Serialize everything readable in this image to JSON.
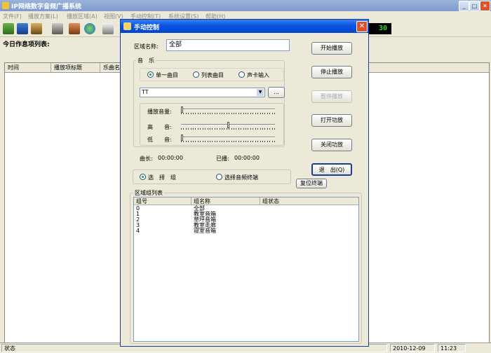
{
  "app": {
    "title": "IP网络数字音频广播系统",
    "window_controls": {
      "minimize": "_",
      "maximize": "□",
      "close": "✕"
    },
    "menus": [
      "文件(F)",
      "播放方案(L)",
      "播放区域(A)",
      "视图(V)",
      "手动控制(T)",
      "系统设置(S)",
      "帮助(H)"
    ],
    "toolbar_icons": [
      "import-icon",
      "schedule-icon",
      "user-icon",
      "tools-icon",
      "speaker-icon",
      "globe-icon",
      "printer-icon"
    ],
    "clock": "30",
    "schedule_title": "今日作息项列表:",
    "table_headers": [
      "时间",
      "播放项标题",
      "乐曲名"
    ],
    "status": {
      "label": "状态",
      "date": "2010-12-09",
      "time": "11:23"
    }
  },
  "dialog": {
    "title": "手动控制",
    "close": "✕",
    "zone_label": "区域名称:",
    "zone_value": "全部",
    "music_group": "音　乐",
    "music_modes": [
      {
        "label": "单一曲目",
        "selected": true
      },
      {
        "label": "列表曲目",
        "selected": false
      },
      {
        "label": "声卡输入",
        "selected": false
      }
    ],
    "track_value": "TT",
    "browse_label": "...",
    "volume_label": "播放音量:",
    "treble_label": "高　　音:",
    "bass_label": "低　　音:",
    "volume_level": 0,
    "treble_level": 0.5,
    "bass_level": 0,
    "duration_label": "曲长:",
    "duration_value": "00:00:00",
    "elapsed_label": "已播:",
    "elapsed_value": "00:00:00",
    "buttons": {
      "play": "开始播放",
      "stop": "停止播放",
      "pause": "暂停播放",
      "amp_on": "打开功放",
      "amp_off": "关闭功放",
      "exit": "退　出(Q)",
      "reset_terminal": "复位终端"
    },
    "target_modes": [
      {
        "label": "选　择　组",
        "selected": true
      },
      {
        "label": "选择音频终端",
        "selected": false
      }
    ],
    "zone_list_title": "区域组列表",
    "zone_columns": [
      "组号",
      "组名称",
      "组状态"
    ],
    "zone_rows": [
      {
        "id": "0",
        "name": "全部",
        "status": ""
      },
      {
        "id": "1",
        "name": "教室音箱",
        "status": ""
      },
      {
        "id": "2",
        "name": "草坪音箱",
        "status": ""
      },
      {
        "id": "3",
        "name": "教室走廊",
        "status": ""
      },
      {
        "id": "4",
        "name": "寝室音箱",
        "status": ""
      }
    ]
  },
  "colors": {
    "dialog_titlebar": "#0a54e0",
    "main_titlebar": "#7f9bcc",
    "clock_text": "#2fd82f",
    "close_button": "#d9532b"
  }
}
